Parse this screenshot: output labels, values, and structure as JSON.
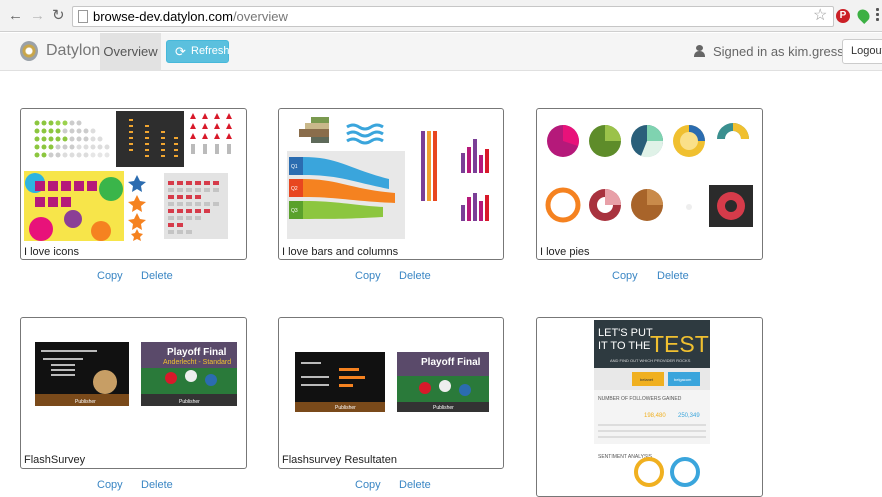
{
  "browser": {
    "url_host": "browse-dev.datylon.com",
    "url_path": "/overview",
    "pinterest_glyph": "P"
  },
  "navbar": {
    "brand": "Datylon",
    "overview_tab": "Overview",
    "refresh_label": "Refresh",
    "signed_in": "Signed in as kim.gressens",
    "logout_label": "Logout"
  },
  "icons": {
    "back": "arrow-left-icon",
    "forward": "arrow-right-icon",
    "reload": "reload-icon",
    "refresh": "refresh-icon",
    "user": "user-icon"
  },
  "colors": {
    "refresh_button": "#5bc0de",
    "link": "#3a86c4"
  },
  "projects": [
    {
      "title": "I love icons",
      "copy": "Copy",
      "delete": "Delete"
    },
    {
      "title": "I love bars and columns",
      "copy": "Copy",
      "delete": "Delete"
    },
    {
      "title": "I love pies",
      "copy": "Copy",
      "delete": "Delete"
    },
    {
      "title": "FlashSurvey",
      "copy": "Copy",
      "delete": "Delete"
    },
    {
      "title": "Flashsurvey Resultaten",
      "copy": "Copy",
      "delete": "Delete"
    },
    {
      "title": "",
      "copy": "",
      "delete": ""
    }
  ],
  "thumb_text": {
    "playoff": "Playoff Final",
    "playoff_sub": "Anderlecht - Standard",
    "publisher": "Publisher",
    "test_line1": "LET'S PUT",
    "test_line2": "IT TO THE",
    "test_big": "TEST",
    "test_sub": "AND FIND OUT WHICH PROVIDER ROCKS",
    "followers": "NUMBER OF FOLLOWERS GAINED",
    "sentiment": "SENTIMENT ANALYSIS",
    "brand_a": "belanet",
    "brand_b": "belgacom",
    "num_a": "198,480",
    "num_b": "250,349"
  }
}
